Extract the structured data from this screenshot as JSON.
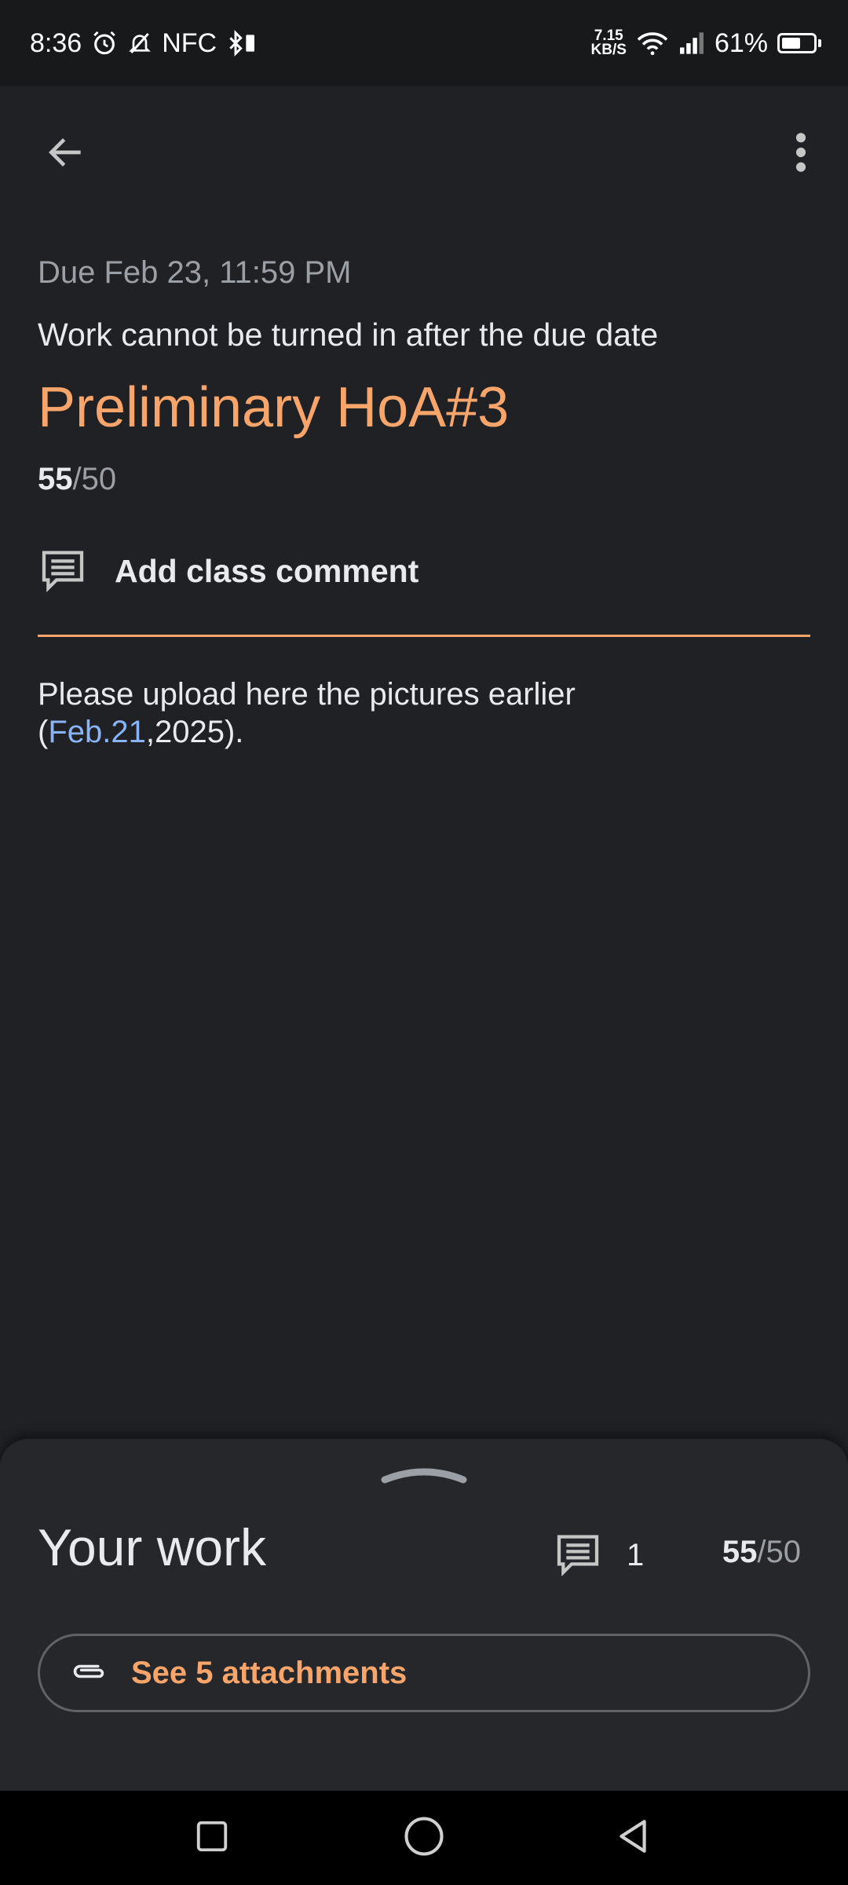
{
  "status_bar": {
    "time": "8:36",
    "nfc_label": "NFC",
    "net_speed_value": "7.15",
    "net_speed_unit": "KB/S",
    "battery_percent": "61%",
    "battery_level": 0.61,
    "icons": [
      "alarm-icon",
      "mute-icon",
      "bluetooth-icon",
      "wifi-icon",
      "signal-icon",
      "battery-icon"
    ]
  },
  "app_bar": {
    "icons": [
      "back-arrow-icon",
      "more-vert-icon"
    ]
  },
  "assignment": {
    "due": "Due Feb 23, 11:59 PM",
    "notice": "Work cannot be turned in after the due date",
    "title": "Preliminary HoA#3",
    "points_earned": "55",
    "points_total": "/50",
    "add_comment_label": "Add class comment",
    "description_line1": "Please upload here the pictures earlier",
    "description_open": "(",
    "description_link": "Feb.21",
    "description_close": ",2025)."
  },
  "your_work": {
    "title": "Your work",
    "comment_count": "1",
    "points_earned": "55",
    "points_total": "/50",
    "attachments_label": "See 5 attachments"
  },
  "colors": {
    "accent": "#f7a56a",
    "background": "#202124",
    "sheet": "#26272a",
    "link": "#8ab4f8"
  }
}
